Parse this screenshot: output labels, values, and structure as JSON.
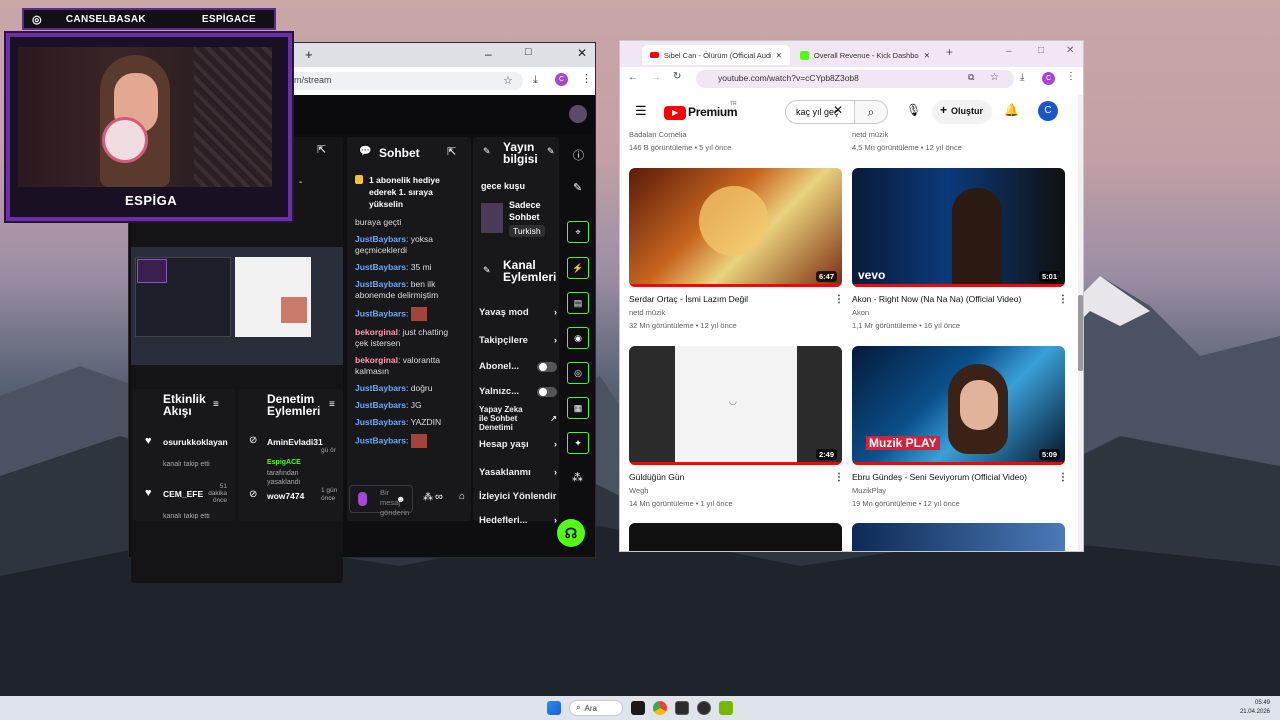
{
  "overlay": {
    "channel_name": "CANSELBASAK",
    "partner_name": "ESPİGACE",
    "cam_label": "ESPİGA"
  },
  "left_window": {
    "address": "om/stream",
    "new_tab": "+",
    "chat": {
      "title": "Sohbet",
      "pinned": "1 abonelik hediye ederek 1. sıraya yükselin",
      "messages": [
        {
          "user": "",
          "text": "buraya geçti"
        },
        {
          "user": "JustBaybars",
          "text": ": yoksa geçmiceklerdi"
        },
        {
          "user": "JustBaybars",
          "text": ": 35 mi"
        },
        {
          "user": "JustBaybars",
          "text": ": ben ilk abonemde delirmiştim"
        },
        {
          "user": "JustBaybars",
          "text": ":"
        },
        {
          "user": "bekorginal",
          "text": ": just chatting çek istersen"
        },
        {
          "user": "bekorginal",
          "text": ": valorantta kalmasın"
        },
        {
          "user": "JustBaybars",
          "text": ": doğru"
        },
        {
          "user": "JustBaybars",
          "text": ": JG"
        },
        {
          "user": "JustBaybars",
          "text": ": YAZDIN"
        },
        {
          "user": "JustBaybars",
          "text": ":"
        }
      ],
      "input_placeholder": "Bir mesaj gönderin"
    },
    "stream_info": {
      "title": "Yayın bilgisi",
      "stream_title": "gece kuşu",
      "category": "Sadece Sohbet",
      "language": "Turkish"
    },
    "channel_actions": {
      "title": "Kanal Eylemleri",
      "items": [
        "Yavaş mod",
        "Takipçilere",
        "Abonel...",
        "Yalnızc...",
        "Yapay Zeka ile Sohbet Denetimi",
        "Hesap yaşı",
        "Yasaklanmı",
        "İzleyici Yönlendir",
        "Hedefleri..."
      ]
    },
    "activity": {
      "title": "Etkinlik Akışı",
      "events": [
        {
          "user": "osurukkoklayan",
          "text": "kanalı takip etti"
        },
        {
          "user": "CEM_EFE",
          "time": "51 dakika önce",
          "text": "kanalı takip etti"
        }
      ]
    },
    "moderation": {
      "title": "Denetim Eylemleri",
      "events": [
        {
          "user": "AminEvladi31",
          "time": "gü ör",
          "by": "EspigACE",
          "action": "tarafından yasaklandı"
        },
        {
          "user": "wow7474",
          "time": "1 gün önce"
        }
      ]
    },
    "tiny_dash": "-",
    "colors": {
      "accent": "#53fc18",
      "purple": "#6b2fa8"
    }
  },
  "right_window": {
    "tabs": [
      {
        "label": "Sibel Can - Ölürüm (Official Audio)"
      },
      {
        "label": "Overall Revenue - Kick Dashboard"
      }
    ],
    "new_tab": "+",
    "url": "youtube.com/watch?v=cCYpb8Z3ob8",
    "logo_text": "Premium",
    "logo_sup": "TR",
    "search_value": "kaç yıl geç",
    "create_label": "Oluştur",
    "avatar_letter": "C",
    "top_partial": [
      {
        "channel": "Badalan Cornelia",
        "meta": "146 B görüntüleme • 5 yıl önce"
      },
      {
        "channel": "netd müzik",
        "meta": "4,5 Mn görüntüleme • 12 yıl önce"
      }
    ],
    "videos": [
      {
        "title": "Serdar Ortaç - İsmi Lazım Değil",
        "channel": "netd müzik",
        "meta": "32 Mn görüntüleme • 12 yıl önce",
        "duration": "6:47"
      },
      {
        "title": "Akon - Right Now (Na Na Na) (Official Video)",
        "channel": "Akon",
        "meta": "1,1 Mr görüntüleme • 16 yıl önce",
        "duration": "5:01",
        "brand": "vevo"
      },
      {
        "title": "Güldüğün Gün",
        "channel": "Wegh",
        "meta": "14 Mn görüntüleme • 1 yıl önce",
        "duration": "2:49"
      },
      {
        "title": "Ebru Gündeş - Seni Seviyorum  (Official Video)",
        "channel": "MuzikPlay",
        "meta": "19 Mn görüntüleme • 12 yıl önce",
        "duration": "5:09",
        "brand": "Muzik PLAY"
      }
    ]
  },
  "taskbar": {
    "search": "Ara",
    "time": "05:49",
    "date": "21.04.2026"
  }
}
